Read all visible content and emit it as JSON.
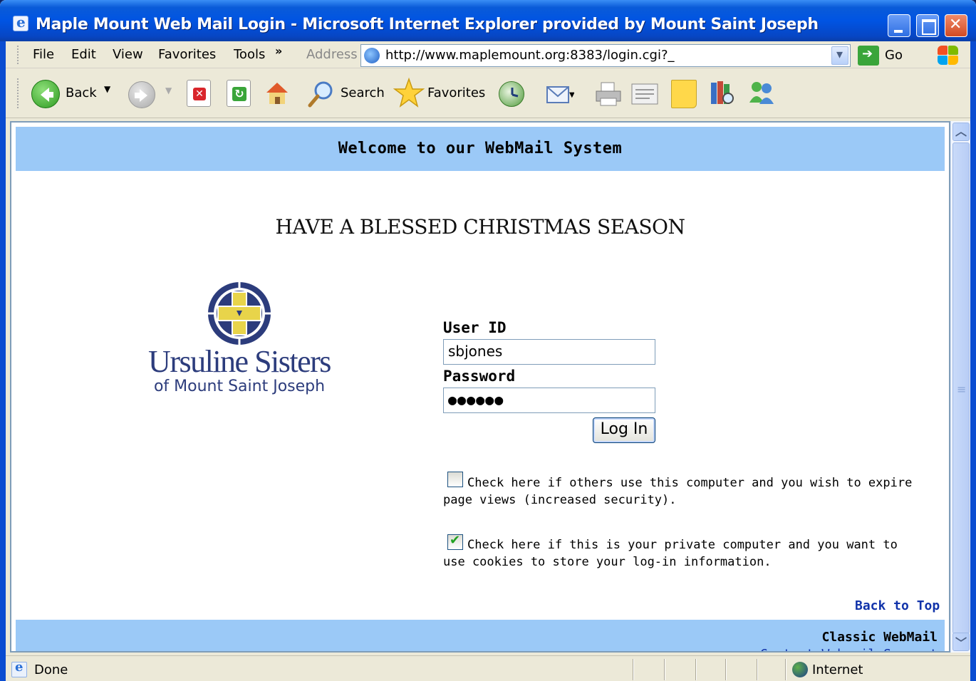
{
  "window": {
    "title": "Maple Mount Web Mail Login - Microsoft Internet Explorer provided by Mount Saint Joseph"
  },
  "menubar": {
    "items": [
      "File",
      "Edit",
      "View",
      "Favorites",
      "Tools"
    ],
    "overflow": "»",
    "address_label": "Address",
    "address_value": "http://www.maplemount.org:8383/login.cgi?_",
    "go_label": "Go"
  },
  "toolbar": {
    "back_label": "Back",
    "search_label": "Search",
    "favorites_label": "Favorites",
    "icons": [
      "back-icon",
      "forward-icon",
      "stop-icon",
      "refresh-icon",
      "home-icon",
      "search-icon",
      "favorites-icon",
      "history-icon",
      "mail-icon",
      "print-icon",
      "edit-icon",
      "discuss-icon",
      "research-icon",
      "messenger-icon"
    ]
  },
  "page": {
    "welcome": "Welcome to our WebMail System",
    "season_message": "HAVE A BLESSED CHRISTMAS SEASON",
    "logo": {
      "name": "Ursuline Sisters",
      "sub": "of Mount Saint Joseph"
    },
    "login": {
      "user_label": "User ID",
      "user_value": "sbjones",
      "password_label": "Password",
      "password_value": "●●●●●●",
      "login_button": "Log In"
    },
    "options": [
      {
        "checked": false,
        "text": "Check here if others use this computer and you wish to expire page views (increased security)."
      },
      {
        "checked": true,
        "text": "Check here if this is your private computer and you want to use cookies to store your log-in information."
      }
    ],
    "back_to_top": "Back to Top",
    "footer": {
      "classic": "Classic WebMail",
      "contact": "Contact Webmail Support"
    }
  },
  "statusbar": {
    "status": "Done",
    "zone": "Internet"
  },
  "colors": {
    "titlebar": "#0054e3",
    "header_band": "#9bc9f7",
    "link": "#1133aa",
    "logo": "#2c3c7c"
  }
}
